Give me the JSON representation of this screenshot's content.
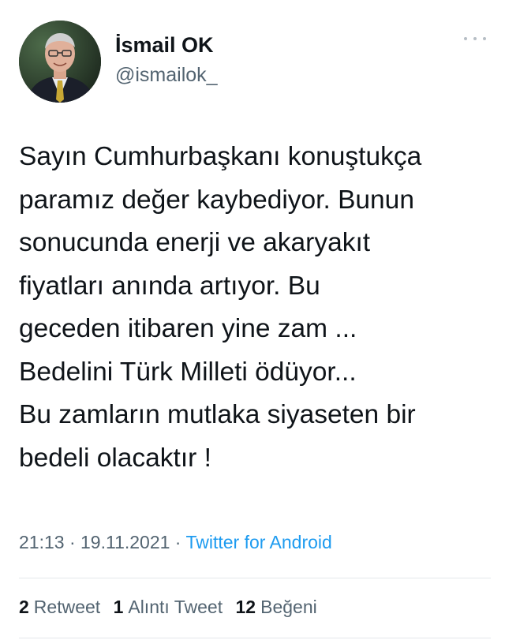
{
  "author": {
    "display_name": "İsmail OK",
    "handle": "@ismailok_"
  },
  "tweet": {
    "lines": [
      "Sayın Cumhurbaşkanı konuştukça",
      "paramız değer kaybediyor. Bunun",
      "sonucunda enerji ve akaryakıt",
      "fiyatları anında artıyor. Bu",
      "geceden itibaren yine zam ...",
      "Bedelini Türk Milleti ödüyor...",
      "Bu zamların mutlaka siyaseten bir",
      "bedeli olacaktır !"
    ]
  },
  "meta": {
    "time": "21:13",
    "separator": " · ",
    "date": "19.11.2021",
    "source": "Twitter for Android"
  },
  "stats": {
    "retweets": {
      "count": "2",
      "label": "Retweet"
    },
    "quotes": {
      "count": "1",
      "label": "Alıntı Tweet"
    },
    "likes": {
      "count": "12",
      "label": "Beğeni"
    }
  },
  "colors": {
    "text": "#0f1419",
    "secondary": "#536471",
    "link": "#1d9bf0",
    "divider": "#e3e7ea"
  },
  "icons": {
    "more": "more-horizontal-icon"
  }
}
